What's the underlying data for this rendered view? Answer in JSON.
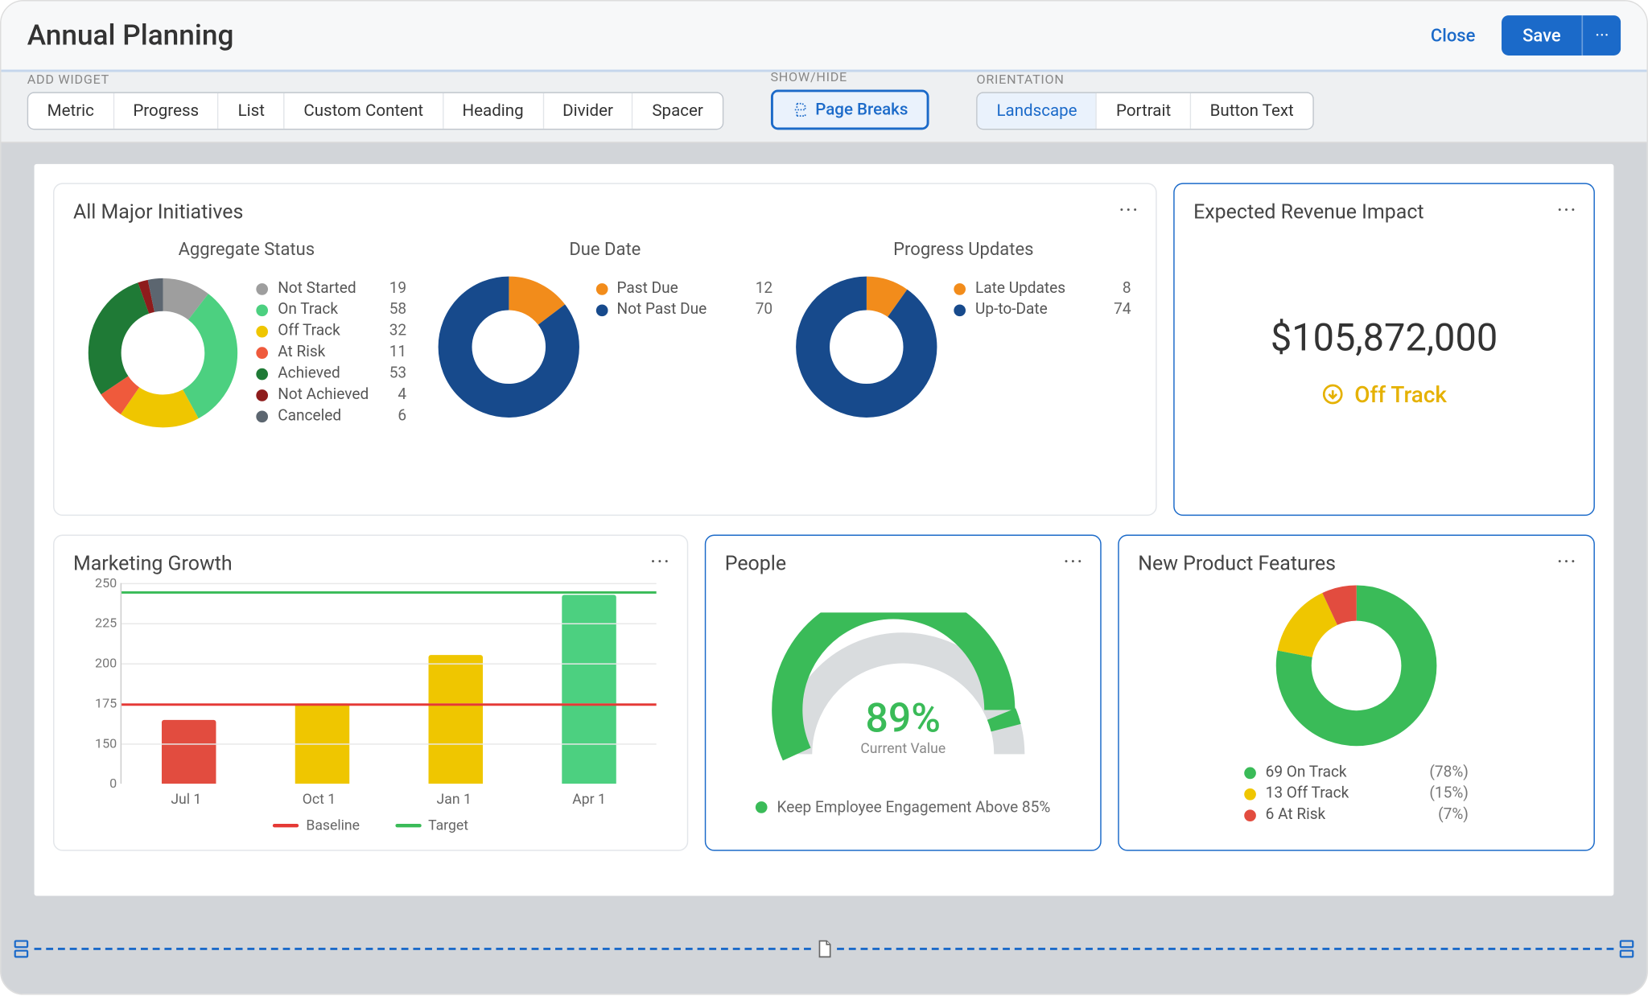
{
  "header": {
    "title": "Annual Planning",
    "close": "Close",
    "save": "Save",
    "more": "···"
  },
  "toolbar": {
    "add_widget_label": "ADD WIDGET",
    "add_widget": [
      "Metric",
      "Progress",
      "List",
      "Custom Content",
      "Heading",
      "Divider",
      "Spacer"
    ],
    "show_hide_label": "SHOW/HIDE",
    "page_breaks": "Page Breaks",
    "orientation_label": "ORIENTATION",
    "orientation": [
      "Landscape",
      "Portrait",
      "Button Text"
    ],
    "orientation_active": 0
  },
  "initiatives": {
    "title": "All Major Initiatives",
    "aggregate": {
      "title": "Aggregate Status",
      "items": [
        {
          "label": "Not Started",
          "value": 19,
          "color": "#9e9e9e"
        },
        {
          "label": "On Track",
          "value": 58,
          "color": "#4cd080"
        },
        {
          "label": "Off Track",
          "value": 32,
          "color": "#efc600"
        },
        {
          "label": "At Risk",
          "value": 11,
          "color": "#ef5a3c"
        },
        {
          "label": "Achieved",
          "value": 53,
          "color": "#1f7a36"
        },
        {
          "label": "Not Achieved",
          "value": 4,
          "color": "#8e1c1c"
        },
        {
          "label": "Canceled",
          "value": 6,
          "color": "#5c6670"
        }
      ]
    },
    "due": {
      "title": "Due Date",
      "items": [
        {
          "label": "Past Due",
          "value": 12,
          "color": "#f28c1b"
        },
        {
          "label": "Not Past Due",
          "value": 70,
          "color": "#174a8c"
        }
      ]
    },
    "progress": {
      "title": "Progress Updates",
      "items": [
        {
          "label": "Late Updates",
          "value": 8,
          "color": "#f28c1b"
        },
        {
          "label": "Up-to-Date",
          "value": 74,
          "color": "#174a8c"
        }
      ]
    }
  },
  "revenue": {
    "title": "Expected Revenue Impact",
    "value": "$105,872,000",
    "status_label": "Off Track"
  },
  "marketing": {
    "title": "Marketing Growth",
    "y_ticks": [
      0,
      150,
      175,
      200,
      225,
      250
    ],
    "baseline": 175,
    "target": 245,
    "bars": [
      {
        "x": "Jul 1",
        "value": 165,
        "color": "#e24c3f"
      },
      {
        "x": "Oct 1",
        "value": 175,
        "color": "#efc600"
      },
      {
        "x": "Jan 1",
        "value": 205,
        "color": "#efc600"
      },
      {
        "x": "Apr 1",
        "value": 243,
        "color": "#4cd080"
      }
    ],
    "legend": {
      "baseline": "Baseline",
      "target": "Target"
    }
  },
  "people": {
    "title": "People",
    "percent": 89,
    "percent_display": "89%",
    "sub": "Current Value",
    "goal": "Keep Employee Engagement Above 85%"
  },
  "npf": {
    "title": "New Product Features",
    "items": [
      {
        "label": "69 On Track",
        "pct": "(78%)",
        "value": 78,
        "color": "#3abb58"
      },
      {
        "label": "13 Off Track",
        "pct": "(15%)",
        "value": 15,
        "color": "#efc600"
      },
      {
        "label": "6 At Risk",
        "pct": "(7%)",
        "value": 7,
        "color": "#e24c3f"
      }
    ]
  },
  "chart_data": [
    {
      "type": "pie",
      "title": "Aggregate Status",
      "categories": [
        "Not Started",
        "On Track",
        "Off Track",
        "At Risk",
        "Achieved",
        "Not Achieved",
        "Canceled"
      ],
      "values": [
        19,
        58,
        32,
        11,
        53,
        4,
        6
      ]
    },
    {
      "type": "pie",
      "title": "Due Date",
      "categories": [
        "Past Due",
        "Not Past Due"
      ],
      "values": [
        12,
        70
      ]
    },
    {
      "type": "pie",
      "title": "Progress Updates",
      "categories": [
        "Late Updates",
        "Up-to-Date"
      ],
      "values": [
        8,
        74
      ]
    },
    {
      "type": "bar",
      "title": "Marketing Growth",
      "categories": [
        "Jul 1",
        "Oct 1",
        "Jan 1",
        "Apr 1"
      ],
      "values": [
        165,
        175,
        205,
        243
      ],
      "ylim": [
        0,
        250
      ],
      "annotations": {
        "Baseline": 175,
        "Target": 245
      }
    },
    {
      "type": "pie",
      "title": "New Product Features",
      "categories": [
        "On Track",
        "Off Track",
        "At Risk"
      ],
      "values": [
        78,
        15,
        7
      ]
    }
  ]
}
